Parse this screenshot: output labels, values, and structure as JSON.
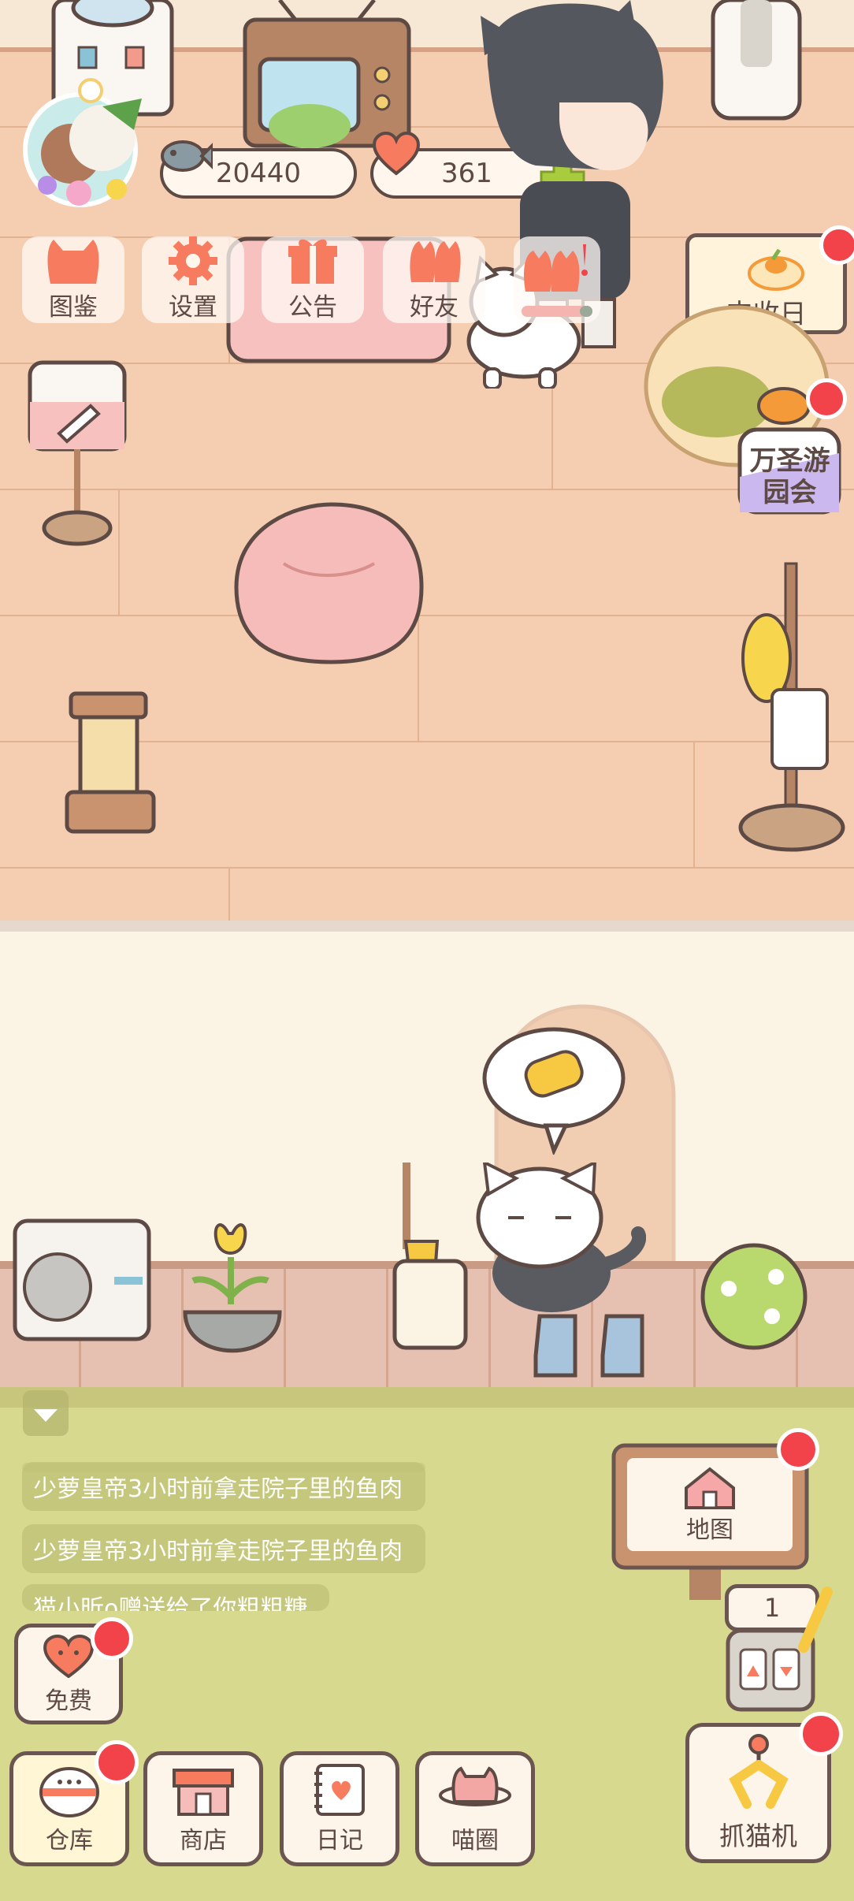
{
  "resources": {
    "fish_count": "20440",
    "heart_count": "361"
  },
  "top_menu": [
    {
      "label": "图鉴",
      "icon": "cat-head-icon"
    },
    {
      "label": "设置",
      "icon": "gear-icon"
    },
    {
      "label": "公告",
      "icon": "gift-icon"
    },
    {
      "label": "好友",
      "icon": "friends-icon"
    }
  ],
  "events": {
    "harvest": "丰收日",
    "halloween_line1": "万圣游",
    "halloween_line2": "园会"
  },
  "chat": [
    "少萝皇帝3小时前拿走院子里的鱼肉",
    "少萝皇帝3小时前拿走院子里的鱼肉",
    "猫小昕o赠送给了你粗粗糖"
  ],
  "map_button": "地图",
  "slot_count": "1",
  "free_button": "免费",
  "bottom_bar": [
    {
      "label": "仓库",
      "icon": "warehouse-icon"
    },
    {
      "label": "商店",
      "icon": "shop-icon"
    },
    {
      "label": "日记",
      "icon": "diary-icon"
    },
    {
      "label": "喵圈",
      "icon": "cat-planet-icon"
    }
  ],
  "claw_machine": "抓猫机",
  "colors": {
    "floor": "#f5cdb0",
    "wall": "#fbf4e5",
    "garden": "#d7d98e",
    "outline": "#5e4a45",
    "badge": "#f2424a",
    "accent": "#f77b5e"
  }
}
